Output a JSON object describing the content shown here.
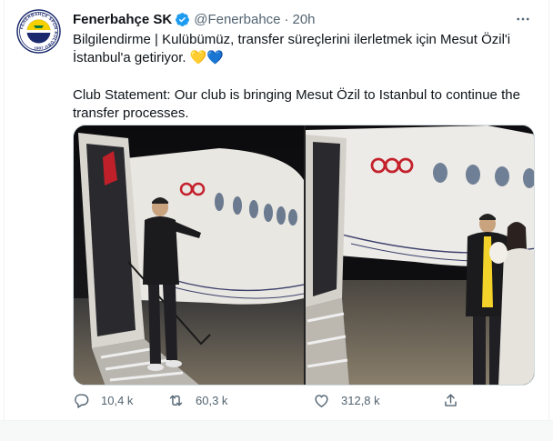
{
  "tweet": {
    "display_name": "Fenerbahçe SK",
    "handle": "@Fenerbahce",
    "separator": "·",
    "time": "20h",
    "text_line1": "Bilgilendirme | Kulübümüz, transfer süreçlerini ilerletmek için Mesut Özil'i İstanbul'a getiriyor.",
    "hearts": "💛💙",
    "text_line2": "Club Statement: Our club is bringing Mesut Özil to Istanbul to continue the transfer processes."
  },
  "avatar": {
    "ring_text": "FENERBAHÇE SPOR KULÜBÜ",
    "year": "1907",
    "colors": {
      "yellow": "#f6d000",
      "navy": "#1a2a6c"
    }
  },
  "actions": {
    "reply_count": "10,4 k",
    "retweet_count": "60,3 k",
    "like_count": "312,8 k"
  },
  "icons": {
    "verified": "verified-badge-icon",
    "more": "more-dots-icon",
    "reply": "reply-icon",
    "retweet": "retweet-icon",
    "like": "heart-icon",
    "share": "share-icon"
  },
  "colors": {
    "verified_blue": "#1d9bf0",
    "text": "#0f1419",
    "secondary": "#536471",
    "border": "#cfd9de"
  }
}
